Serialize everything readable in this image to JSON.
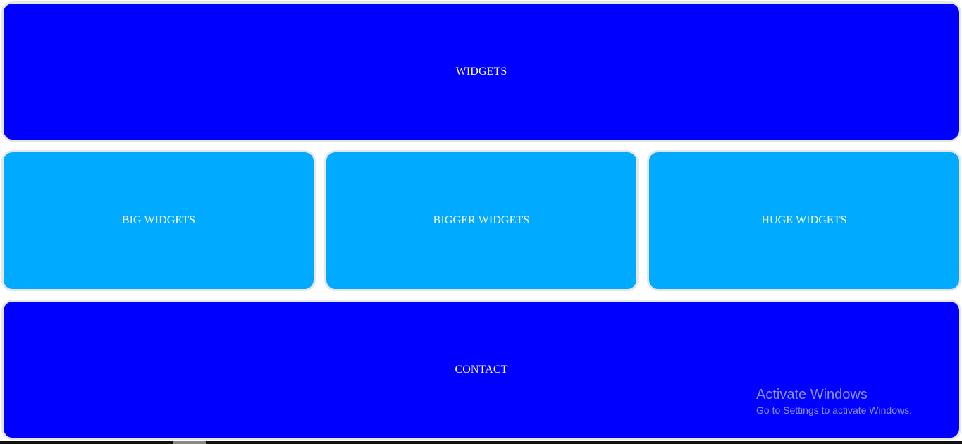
{
  "hero": {
    "label": "WIDGETS"
  },
  "cards": [
    {
      "label": "BIG WIDGETS"
    },
    {
      "label": "BIGGER WIDGETS"
    },
    {
      "label": "HUGE WIDGETS"
    }
  ],
  "contact": {
    "label": "CONTACT"
  },
  "watermark": {
    "title": "Activate Windows",
    "subtitle": "Go to Settings to activate Windows."
  },
  "colors": {
    "primary": "#0000ff",
    "secondary": "#00aaff",
    "text": "#ffffff",
    "border": "#e6e6e6"
  }
}
